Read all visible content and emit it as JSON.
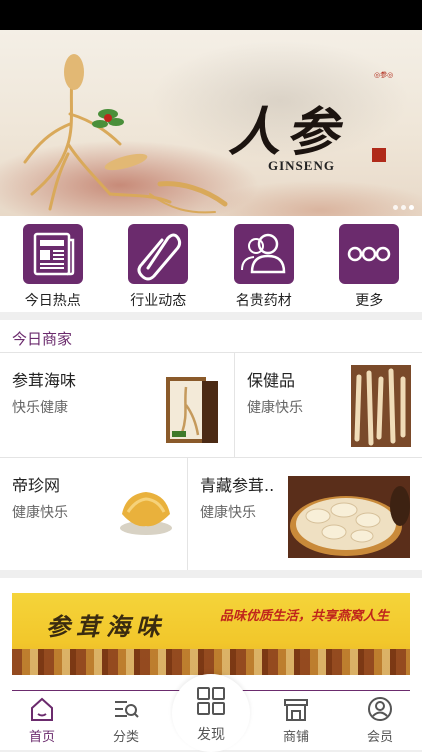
{
  "banner": {
    "title": "人参",
    "subtitle": "GINSENG",
    "logo_text": "◎参◎",
    "pager_count": 3
  },
  "categories": [
    {
      "label": "今日热点",
      "icon": "newspaper-icon"
    },
    {
      "label": "行业动态",
      "icon": "paperclip-icon"
    },
    {
      "label": "名贵药材",
      "icon": "people-icon"
    },
    {
      "label": "更多",
      "icon": "more-dots-icon"
    }
  ],
  "merchants": {
    "section_title": "今日商家",
    "items": [
      {
        "name": "参茸海味",
        "slogan": "快乐健康",
        "image": "ginseng-box-image"
      },
      {
        "name": "保健品",
        "slogan": "健康快乐",
        "image": "ginseng-roots-image"
      },
      {
        "name": "帝珍网",
        "slogan": "健康快乐",
        "image": "bird-nest-image"
      },
      {
        "name": "青藏参茸..",
        "slogan": "健康快乐",
        "image": "sliced-ginseng-image"
      }
    ]
  },
  "ad": {
    "left_text": "参茸海味",
    "right_text": "品味优质生活，共享燕窝人生"
  },
  "tabbar": {
    "tabs": [
      {
        "label": "首页",
        "icon": "home-icon",
        "active": true
      },
      {
        "label": "分类",
        "icon": "category-search-icon",
        "active": false
      },
      {
        "label": "发现",
        "icon": "grid-icon",
        "active": false
      },
      {
        "label": "商铺",
        "icon": "shop-icon",
        "active": false
      },
      {
        "label": "会员",
        "icon": "user-icon",
        "active": false
      }
    ]
  },
  "colors": {
    "accent": "#6b2b6d",
    "ad_bg": "#f2c72b",
    "ad_red": "#c0261c"
  }
}
